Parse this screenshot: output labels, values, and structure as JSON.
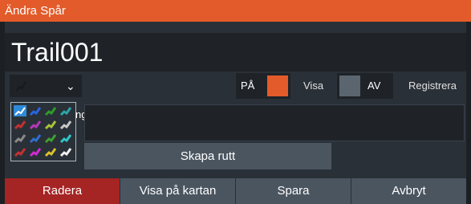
{
  "dialog": {
    "title": "Ändra Spår",
    "trail_name": "Trail001",
    "pa_label": "PÅ",
    "visa_label": "Visa",
    "av_label": "AV",
    "registrera_label": "Registrera",
    "text_field_fragment": "ng",
    "create_route_label": "Skapa rutt",
    "pa_color": "#e35b2a",
    "av_color": "#5a6570",
    "selected_color": "#2e8ad8",
    "palette_colors": [
      "#2e8ad8",
      "#2766e0",
      "#2f9c2e",
      "#2aa6a8",
      "#c53030",
      "#b23ab8",
      "#a9c33a",
      "#c8c8c8",
      "#8a8a8a",
      "#2f6fd0",
      "#3ea02f",
      "#2ec7c7",
      "#c73030",
      "#d12bd4",
      "#d8c22a",
      "#f0f0f0"
    ]
  },
  "bottom_bar": {
    "delete_label": "Radera",
    "show_on_map_label": "Visa på kartan",
    "save_label": "Spara",
    "cancel_label": "Avbryt"
  }
}
